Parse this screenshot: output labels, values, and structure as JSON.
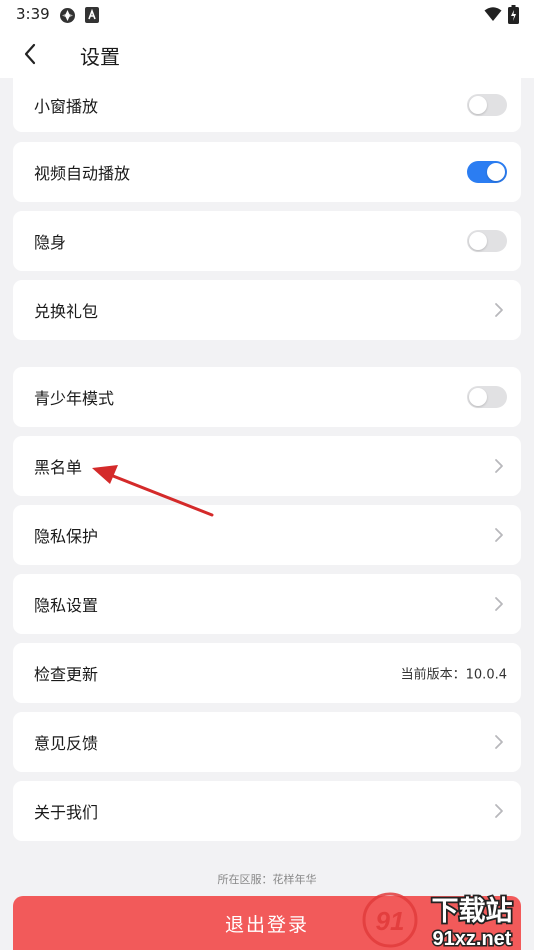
{
  "status_bar": {
    "time": "3:39"
  },
  "header": {
    "title": "设置"
  },
  "settings": {
    "pip": {
      "label": "小窗播放",
      "enabled": false
    },
    "autoplay": {
      "label": "视频自动播放",
      "enabled": true
    },
    "invisible": {
      "label": "隐身",
      "enabled": false
    },
    "redeem": {
      "label": "兑换礼包"
    },
    "teen_mode": {
      "label": "青少年模式",
      "enabled": false
    },
    "blacklist": {
      "label": "黑名单"
    },
    "privacy_protect": {
      "label": "隐私保护"
    },
    "privacy_settings": {
      "label": "隐私设置"
    },
    "check_update": {
      "label": "检查更新",
      "version_text": "当前版本：10.0.4"
    },
    "feedback": {
      "label": "意见反馈"
    },
    "about": {
      "label": "关于我们"
    }
  },
  "footer": {
    "region_text": "所在区服：花样年华",
    "logout_label": "退出登录"
  },
  "watermark": {
    "brand": "下载站",
    "site": "91xz.net",
    "digits": "91"
  },
  "colors": {
    "accent": "#2b7df2",
    "logout": "#f25a5a",
    "annotation_arrow": "#d42a2a",
    "watermark_red": "#e23c3c"
  }
}
